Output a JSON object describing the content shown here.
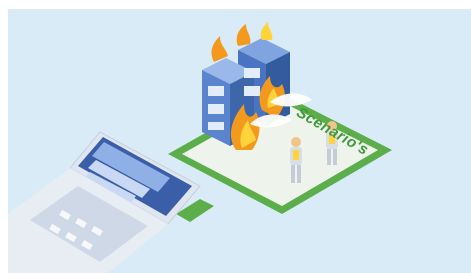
{
  "scene": {
    "label": "Scenario's"
  },
  "colors": {
    "background": "#d8ebf7",
    "platform_green": "#5cae4a",
    "platform_top": "#e6f0e2",
    "laptop_body": "#e8edf4",
    "screen_blue": "#3b5ea8",
    "server_blue": "#4a74c2",
    "fire_orange": "#f39a1e",
    "fire_yellow": "#ffd33a",
    "label_green": "#3e9a3a"
  },
  "icons": [
    "laptop-icon",
    "server-rack-icon",
    "fire-icon",
    "firefighter-icon",
    "extinguisher-spray-icon"
  ]
}
